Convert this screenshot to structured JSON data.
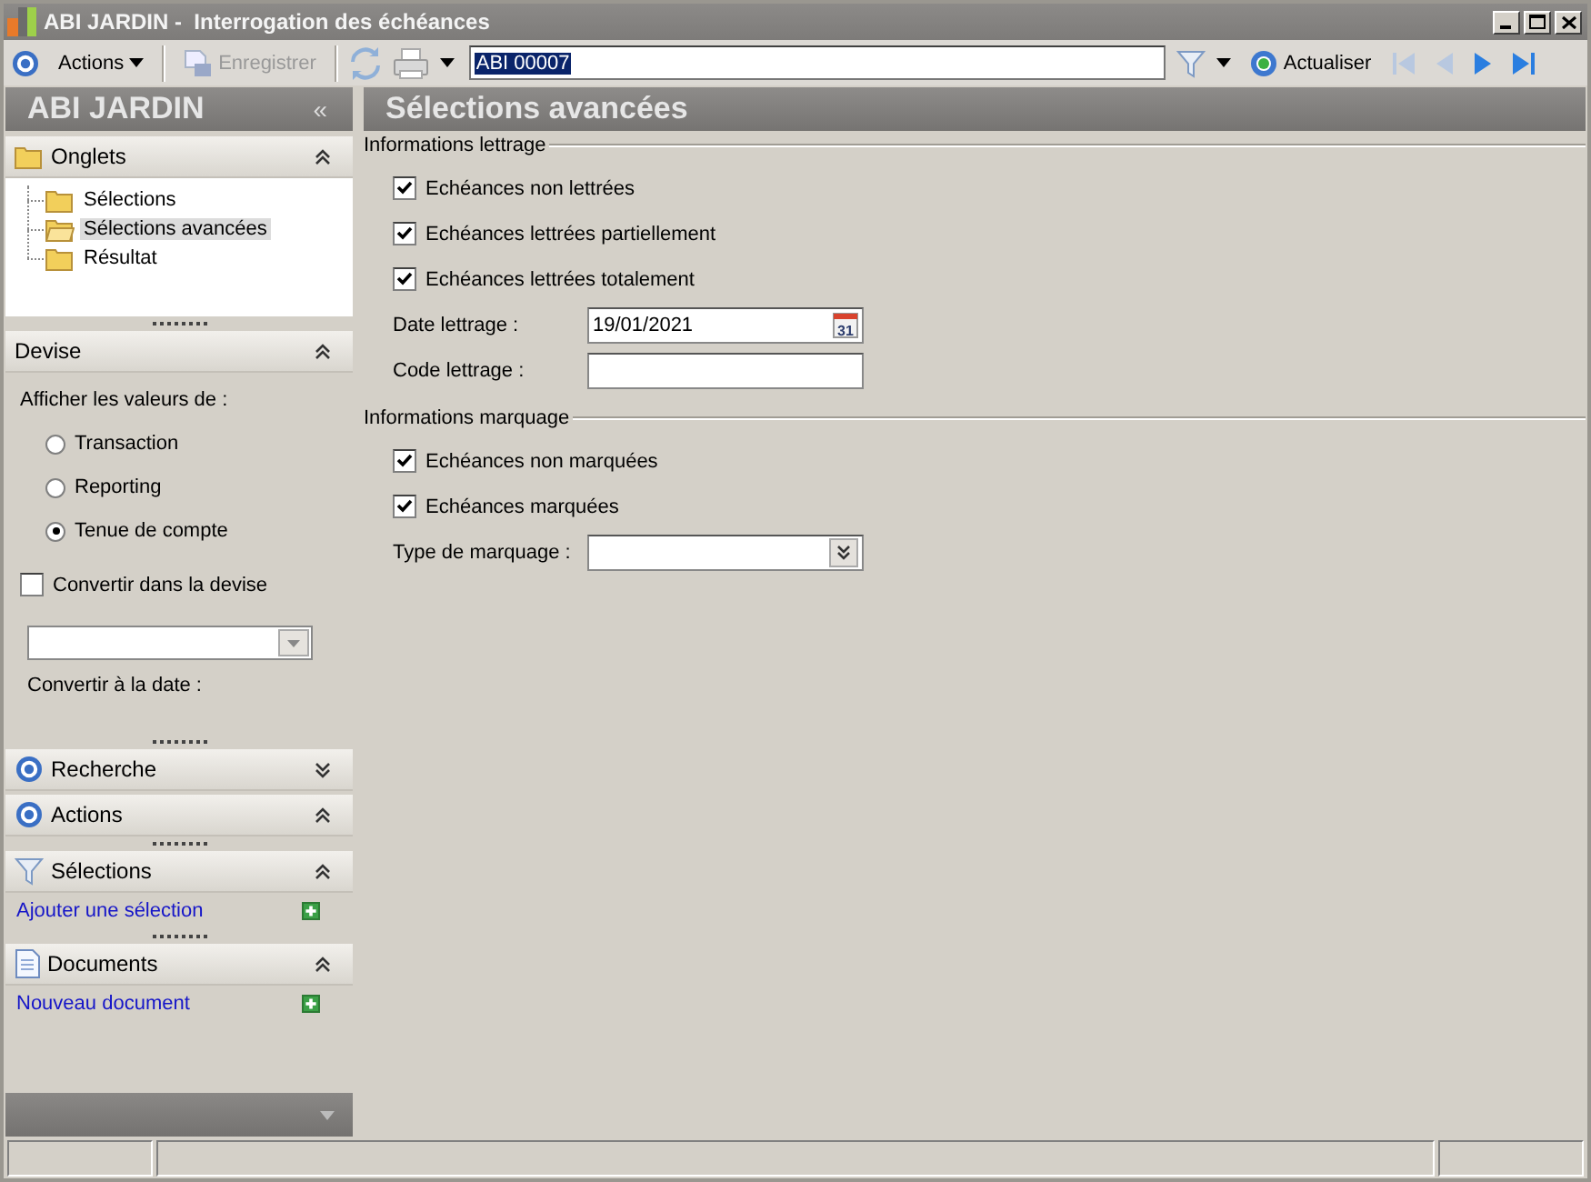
{
  "window": {
    "title": "ABI JARDIN -  Interrogation des échéances"
  },
  "toolbar": {
    "actions_label": "Actions",
    "save": {
      "label": "Enregistrer",
      "disabled": true
    },
    "record_field": {
      "value": "ABI 00007",
      "text_selected": true
    },
    "refresh_label": "Actualiser",
    "nav": [
      {
        "kind": "first",
        "disabled": true
      },
      {
        "kind": "previous",
        "disabled": true
      },
      {
        "kind": "next",
        "disabled": false
      },
      {
        "kind": "last",
        "disabled": false
      }
    ]
  },
  "sidebar": {
    "title": "ABI JARDIN",
    "collapse_glyph": "«",
    "sections": [
      {
        "kind": "tree",
        "title": "Onglets",
        "expanded": true,
        "items": [
          {
            "label": "Sélections",
            "selected": false
          },
          {
            "label": "Sélections avancées",
            "selected": true
          },
          {
            "label": "Résultat",
            "selected": false
          }
        ]
      },
      {
        "kind": "currency",
        "title": "Devise",
        "expanded": true,
        "prompt": "Afficher les valeurs de :",
        "options": [
          {
            "label": "Transaction",
            "selected": false
          },
          {
            "label": "Reporting",
            "selected": false
          },
          {
            "label": "Tenue de compte",
            "selected": true
          }
        ],
        "convert": {
          "label": "Convertir dans la devise",
          "checked": false
        },
        "date_label": "Convertir à la date :"
      },
      {
        "kind": "panel",
        "title": "Recherche",
        "expanded": false
      },
      {
        "kind": "panel",
        "title": "Actions",
        "expanded": true
      },
      {
        "kind": "filters",
        "title": "Sélections",
        "expanded": true,
        "link": "Ajouter une sélection"
      },
      {
        "kind": "documents",
        "title": "Documents",
        "expanded": true,
        "link": "Nouveau document"
      }
    ]
  },
  "main": {
    "title": "Sélections avancées",
    "groups": [
      {
        "title": "Informations lettrage",
        "rows": [
          {
            "kind": "checkbox",
            "label": "Echéances non lettrées",
            "checked": true
          },
          {
            "kind": "checkbox",
            "label": "Echéances lettrées partiellement",
            "checked": true
          },
          {
            "kind": "checkbox",
            "label": "Echéances lettrées totalement",
            "checked": true
          },
          {
            "kind": "date",
            "label": "Date lettrage :",
            "value": "19/01/2021",
            "calendar_day": "31"
          },
          {
            "kind": "text",
            "label": "Code lettrage :"
          }
        ]
      },
      {
        "title": "Informations marquage",
        "rows": [
          {
            "kind": "checkbox",
            "label": "Echéances non marquées",
            "checked": true
          },
          {
            "kind": "checkbox",
            "label": "Echéances marquées",
            "checked": true
          },
          {
            "kind": "combo",
            "label": "Type de marquage :"
          }
        ]
      }
    ]
  }
}
